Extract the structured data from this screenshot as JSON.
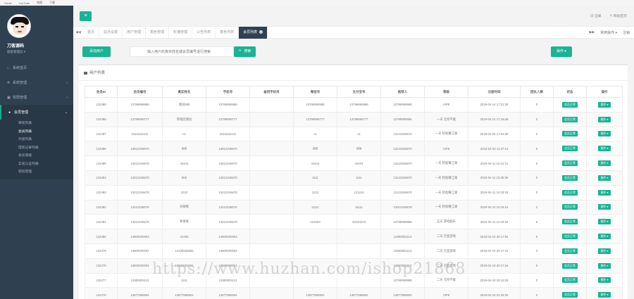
{
  "bookmarks": [
    "Gmail",
    "YouTube",
    "地图",
    "下载"
  ],
  "sidebar": {
    "username": "刀客源码",
    "role": "超级管理员 ▾",
    "menu": [
      {
        "label": "系统首页",
        "icon": "home-icon"
      },
      {
        "label": "系统管理",
        "icon": "gear-icon",
        "arrow": "‹"
      },
      {
        "label": "权限管理",
        "icon": "lock-icon",
        "arrow": "‹"
      },
      {
        "label": "会员管理",
        "icon": "user-icon",
        "arrow": "⌄"
      }
    ],
    "submenu": [
      "审核列表",
      "会员列表",
      "升级列表",
      "提现记录列表",
      "会员等级",
      "实名认证列表",
      "密码管理"
    ]
  },
  "topbar": {
    "hamburger": "≡",
    "right_items": [
      "▦ 全屏",
      "✎ 网站首页"
    ]
  },
  "tabs": {
    "left_nav": "◀◀",
    "right_nav": "▶▶",
    "items": [
      "首页",
      "站点设置",
      "用户管理",
      "角色管理",
      "轮播管理",
      "公告列表",
      "角色列表",
      "会员列表"
    ],
    "active_index": 7,
    "close_glyph": "×",
    "tab_ops": "常用操作 ▾",
    "logout": "注销"
  },
  "toolbar": {
    "add_label": "添加用户",
    "search_placeholder": "输入用户的真实姓名或会员编号进行搜索",
    "search_label": "🔍 搜索",
    "ops_label": "操作 ▾"
  },
  "panel": {
    "title": "用户列表"
  },
  "table": {
    "headers": [
      "会员ID",
      "会员编号",
      "真实姓名",
      "手机号",
      "备用手机号",
      "微信号",
      "支付宝号",
      "推荐人",
      "等级",
      "注册时间",
      "团队人数",
      "状态",
      "操作"
    ],
    "status_label": "会员正常",
    "op_label": "操作 ▾",
    "rows": [
      [
        "132489",
        "13799999988",
        "测试888",
        "13799999988",
        "",
        "13799999988",
        "13799999988",
        "13799999988",
        "VIP8",
        "2019-04-14 17:21:28",
        "0"
      ],
      [
        "132488",
        "13799999777",
        "参观团测试",
        "13799999777",
        "",
        "13799999777",
        "13799999777",
        "13799999996",
        "一天 无所不能",
        "2019-04-14 17:18:48",
        "0"
      ],
      [
        "132487",
        "15111111111",
        "c1",
        "15111111111",
        "",
        "c1",
        "c1",
        "13123456670",
        "一天 轻松赚江湖",
        "2019-04-03 17:04:35",
        "0"
      ],
      [
        "132486",
        "13612345670",
        "ffffff",
        "13612345670",
        "",
        "ffffff",
        "ffffff",
        "13123456670",
        "VIP8",
        "2019-04-03 11:37:13",
        "0"
      ],
      [
        "132485",
        "13512345678",
        "44444",
        "13512345670",
        "",
        "44444",
        "44444",
        "13123456670",
        "一天 轻松赚江湖",
        "2019-04-11 15:41:21",
        "0"
      ],
      [
        "132484",
        "13312345678",
        "tttttt",
        "13312345678",
        "",
        "1111",
        "1111",
        "13123456670",
        "一天 轻松赚江湖",
        "2019-04-11 15:35:35",
        "0"
      ],
      [
        "132483",
        "13212345678",
        "2222",
        "13212345678",
        "",
        "1212",
        "121212",
        "13123456670",
        "一天 轻松赚江湖",
        "2019-04-11 15:33:18",
        "0"
      ],
      [
        "132482",
        "13112345678",
        "谷歌哦",
        "13112345678",
        "",
        "11111",
        "11111",
        "13012345678",
        "一天 轻松赚江湖",
        "2019-04-11 15:19:15",
        "2"
      ],
      [
        "132481",
        "13012345678",
        "谁谁谁",
        "13012345678",
        "",
        "123253",
        "32234234",
        "13799999988",
        "五天 游戏娱乐",
        "2019-04-11 14:19:52",
        "5"
      ],
      [
        "132480",
        "13800000003",
        "41465",
        "13800000003",
        "",
        "",
        "",
        "13800001113",
        "二天 百变游戏",
        "2019-04-10 20:17:52",
        "0"
      ],
      [
        "132479",
        "13800000002",
        "13105555555",
        "13800000002",
        "",
        "",
        "",
        "13800001113",
        "二天 百变游戏",
        "2019-04-10 20:17:31",
        "0"
      ],
      [
        "132478",
        "13800000001",
        "13800000001",
        "13800000001",
        "",
        "",
        "",
        "13800001113",
        "二天 百变游戏",
        "2019-04-10 20:17:16",
        "0"
      ],
      [
        "132477",
        "13800001113",
        "1111",
        "13800001113",
        "",
        "",
        "",
        "13799999988",
        "二天 无所不能",
        "2019-04-10 20:13:26",
        "0"
      ],
      [
        "132476",
        "13877888904",
        "13877888904",
        "13877888904",
        "",
        "13877888904",
        "13877888904",
        "13877889900",
        "VIP8",
        "2019-04-10 01:34:02",
        "0"
      ]
    ]
  },
  "watermark": "https://www.huzhan.com/ishop21868"
}
